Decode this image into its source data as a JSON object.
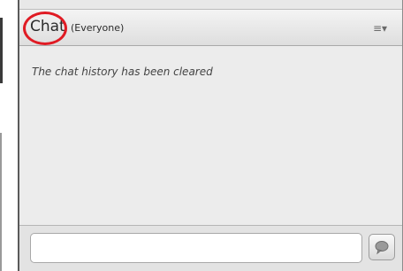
{
  "chat_panel": {
    "title": "Chat",
    "audience": "(Everyone)",
    "menu_icon": "menu-lines-icon",
    "history_message": "The chat history has been cleared",
    "input": {
      "value": "",
      "placeholder": ""
    },
    "send_icon": "speech-bubble-icon"
  },
  "colors": {
    "highlight_ring": "#e01b24",
    "header_gradient_top": "#f4f4f4",
    "header_gradient_bottom": "#dedede",
    "history_background": "#ececec",
    "composer_background": "#e3e3e3"
  }
}
